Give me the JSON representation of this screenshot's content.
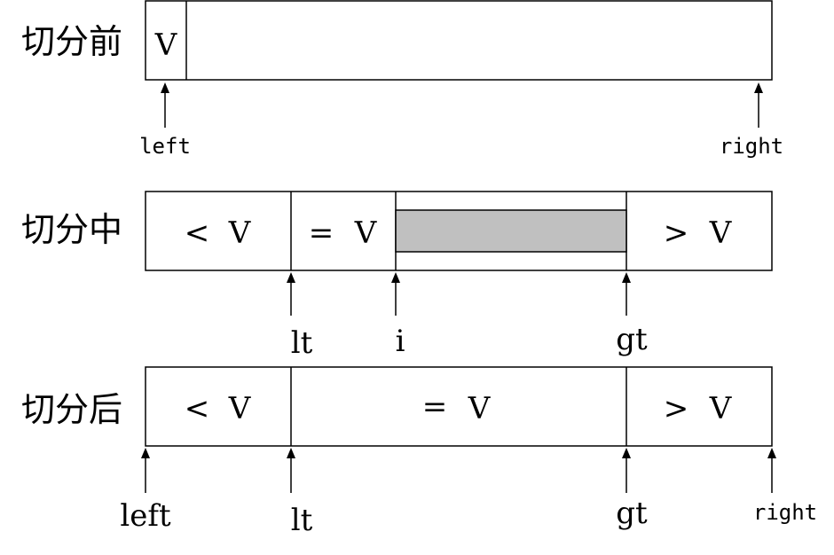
{
  "rows": [
    {
      "label": "切分前",
      "cells": [
        "V"
      ],
      "pointers": [
        "left",
        "right"
      ]
    },
    {
      "label": "切分中",
      "cells": [
        "<",
        "V",
        "=",
        "V",
        ">",
        "V"
      ],
      "pointers": [
        "lt",
        "i",
        "gt"
      ]
    },
    {
      "label": "切分后",
      "cells": [
        "<",
        "V",
        "=",
        "V",
        ">",
        "V"
      ],
      "pointers": [
        "left",
        "lt",
        "gt",
        "right"
      ]
    }
  ],
  "colors": {
    "line": "#000000",
    "shaded": "#c0c0c0",
    "background": "#ffffff"
  }
}
